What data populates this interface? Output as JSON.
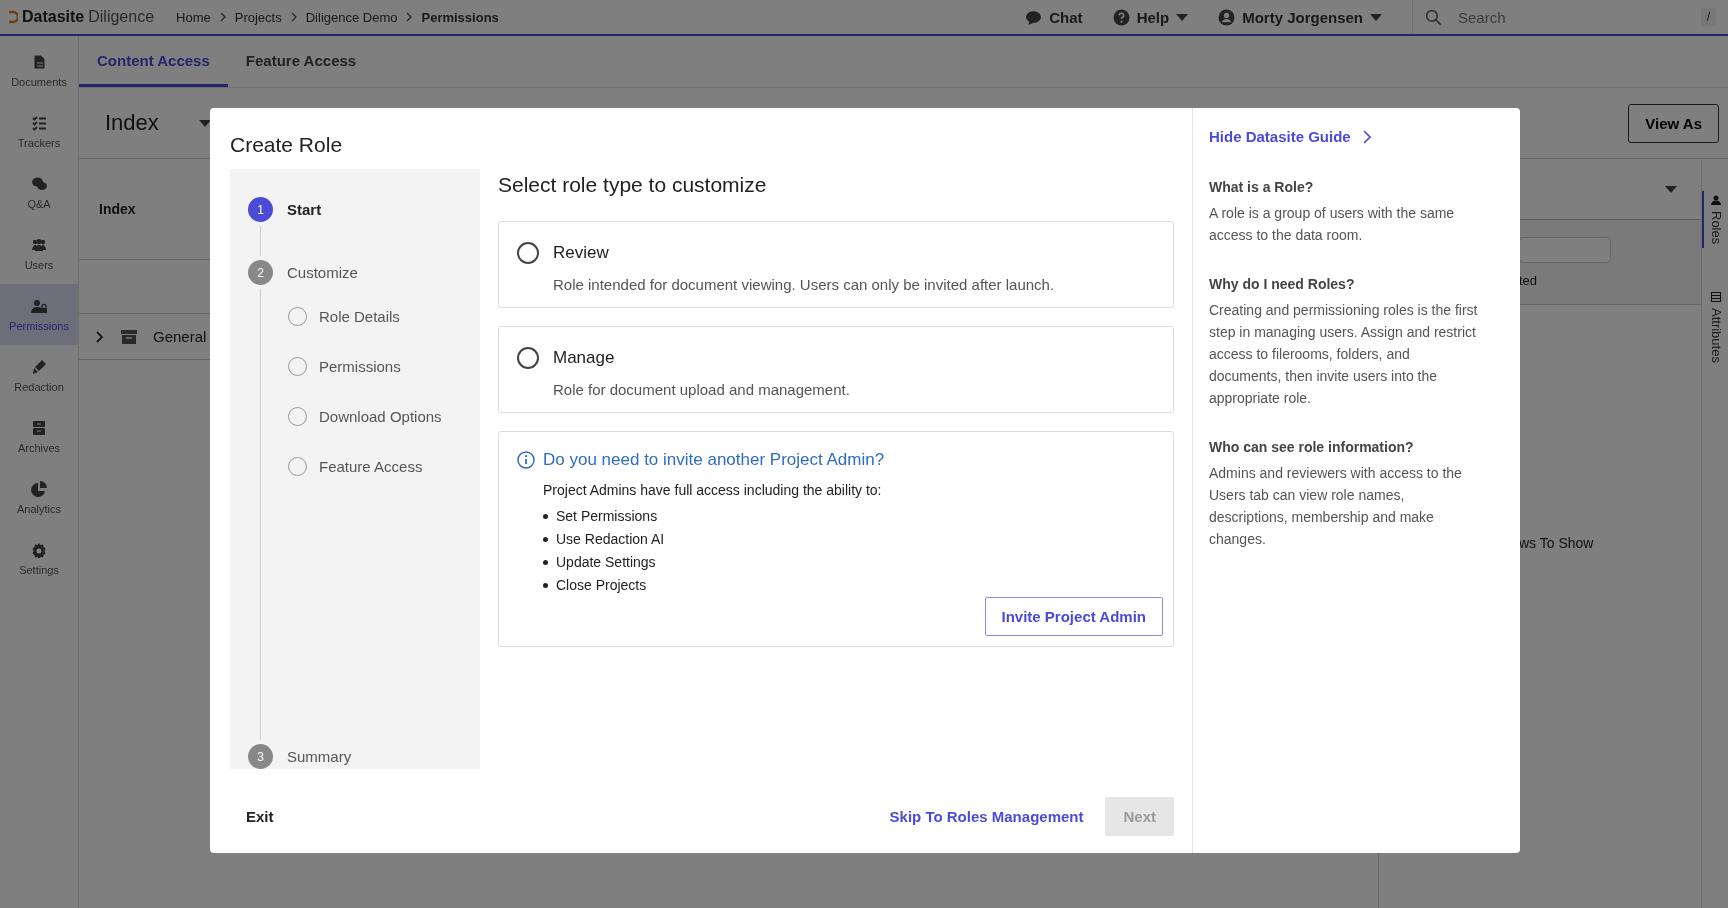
{
  "topbar": {
    "brand": "Datasite",
    "product": "Diligence",
    "breadcrumbs": [
      "Home",
      "Projects",
      "Diligence Demo",
      "Permissions"
    ],
    "chat": "Chat",
    "help": "Help",
    "user": "Morty Jorgensen",
    "search": {
      "placeholder": "Search",
      "shortcut": "/"
    }
  },
  "sidebar": {
    "items": [
      {
        "label": "Documents",
        "selected": false
      },
      {
        "label": "Trackers",
        "selected": false
      },
      {
        "label": "Q&A",
        "selected": false
      },
      {
        "label": "Users",
        "selected": false
      },
      {
        "label": "Permissions",
        "selected": true
      },
      {
        "label": "Redaction",
        "selected": false
      },
      {
        "label": "Archives",
        "selected": false
      },
      {
        "label": "Analytics",
        "selected": false
      },
      {
        "label": "Settings",
        "selected": false
      }
    ]
  },
  "tabs": [
    {
      "label": "Content Access",
      "selected": true
    },
    {
      "label": "Feature Access",
      "selected": false
    }
  ],
  "index_header": {
    "title": "Index",
    "view_as": "View As"
  },
  "table": {
    "column_1": "Index",
    "rows": [
      {
        "label": "General",
        "expanded": false
      }
    ]
  },
  "right_panel": {
    "fragment_1": "ted",
    "fragment_2": "ws To Show"
  },
  "side_tabs": [
    {
      "label": "Roles",
      "selected": true
    },
    {
      "label": "Attributes",
      "selected": false
    }
  ],
  "modal": {
    "title": "Create Role",
    "steps": [
      {
        "number": "1",
        "label": "Start",
        "selected": true
      },
      {
        "number": "2",
        "label": "Customize",
        "selected": false,
        "children": [
          {
            "label": "Role Details",
            "completed": false
          },
          {
            "label": "Permissions",
            "completed": false
          },
          {
            "label": "Download Options",
            "completed": false
          },
          {
            "label": "Feature Access",
            "completed": false
          }
        ]
      },
      {
        "number": "3",
        "label": "Summary",
        "selected": false
      }
    ],
    "heading": "Select role type to customize",
    "options": [
      {
        "label": "Review",
        "description": "Role intended for document viewing. Users can only be invited after launch.",
        "selected": false
      },
      {
        "label": "Manage",
        "description": "Role for document upload and management.",
        "selected": false
      }
    ],
    "info": {
      "title": "Do you need to invite another Project Admin?",
      "intro": "Project Admins have full access including the ability to:",
      "bullets": [
        "Set Permissions",
        "Use Redaction AI",
        "Update Settings",
        "Close Projects"
      ],
      "button": "Invite Project Admin"
    },
    "footer": {
      "exit": "Exit",
      "skip": "Skip To Roles Management",
      "next": {
        "label": "Next",
        "disabled": true
      }
    },
    "guide": {
      "hide_label": "Hide Datasite Guide",
      "sections": [
        {
          "title": "What is a Role?",
          "text": "A role is a group of users with the same access to the data room."
        },
        {
          "title": "Why do I need Roles?",
          "text": "Creating and permissioning roles is the first step in managing users. Assign and restrict access to filerooms, folders, and documents, then invite users into the appropriate role."
        },
        {
          "title": "Who can see role information?",
          "text": "Admins and reviewers with access to the Users tab can view role names, descriptions, membership and make changes."
        }
      ]
    }
  }
}
